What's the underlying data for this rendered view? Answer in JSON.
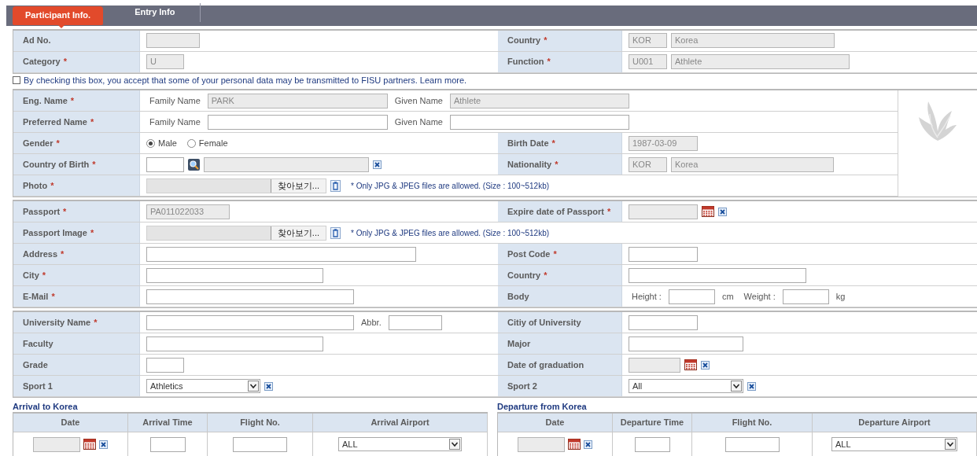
{
  "tabs": [
    {
      "label": "Participant Info.",
      "selected": true
    },
    {
      "label": "Entry Info",
      "selected": false
    }
  ],
  "sections": [
    {
      "rows": [
        {
          "left": {
            "label": "Ad No.",
            "items": [
              {
                "kind": "input",
                "disabled": true
              }
            ]
          },
          "right": {
            "label": "Country",
            "mark": "*",
            "items": [
              {
                "kind": "input",
                "disabled": true,
                "value": "KOR"
              },
              {
                "kind": "input",
                "disabled": true,
                "value": "Korea"
              }
            ]
          }
        },
        {
          "left": {
            "label": "Category",
            "mark": "*",
            "items": [
              {
                "kind": "input",
                "disabled": true,
                "value": "U"
              }
            ]
          },
          "right": {
            "label": "Function",
            "mark": "*",
            "items": [
              {
                "kind": "input",
                "disabled": true,
                "value": "U001"
              },
              {
                "kind": "input",
                "disabled": true,
                "value": "Athlete"
              }
            ]
          }
        }
      ]
    },
    {
      "consent": {
        "checked": false,
        "text": "By checking this box, you accept that some of your personal data may be transmitted to FISU partners.",
        "link": "Learn more."
      }
    },
    {
      "photo": true,
      "rows": [
        {
          "left": {
            "label": "Eng. Name",
            "mark": "*",
            "items": [
              {
                "kind": "caption",
                "text": "Family Name"
              },
              {
                "kind": "input",
                "disabled": true,
                "value": "PARK"
              },
              {
                "kind": "caption",
                "text": "Given Name"
              },
              {
                "kind": "input",
                "disabled": true,
                "value": "Athlete"
              }
            ]
          }
        },
        {
          "left": {
            "label": "Preferred Name",
            "mark": "*",
            "items": [
              {
                "kind": "caption",
                "text": "Family Name"
              },
              {
                "kind": "input",
                "disabled": false
              },
              {
                "kind": "caption",
                "text": "Given Name"
              },
              {
                "kind": "input",
                "disabled": false
              }
            ]
          }
        },
        {
          "left": {
            "label": "Gender",
            "mark": "*",
            "items": [
              {
                "kind": "radio",
                "label": "Male",
                "selected": true
              },
              {
                "kind": "radio",
                "label": "Female",
                "selected": false
              }
            ]
          },
          "right": {
            "label": "Birth Date",
            "mark": "*",
            "items": [
              {
                "kind": "input",
                "disabled": true,
                "value": "1987-03-09"
              }
            ]
          }
        },
        {
          "left": {
            "label": "Country of Birth",
            "mark": "*",
            "items": [
              {
                "kind": "input",
                "disabled": false
              },
              {
                "kind": "search"
              },
              {
                "kind": "input",
                "disabled": true
              },
              {
                "kind": "clear"
              }
            ]
          },
          "right": {
            "label": "Nationality",
            "mark": "*",
            "items": [
              {
                "kind": "input",
                "disabled": true,
                "value": "KOR"
              },
              {
                "kind": "input",
                "disabled": true,
                "value": "Korea"
              }
            ]
          }
        },
        {
          "left": {
            "label": "Photo",
            "mark": "*",
            "items": [
              {
                "kind": "file",
                "button": "찾아보기..."
              },
              {
                "kind": "delete"
              },
              {
                "kind": "note",
                "text": "* Only JPG & JPEG files are allowed. (Size : 100~512kb)"
              }
            ]
          }
        }
      ]
    },
    {
      "rows": [
        {
          "left": {
            "label": "Passport",
            "mark": "*",
            "items": [
              {
                "kind": "input",
                "disabled": true,
                "value": "PA011022033"
              }
            ]
          },
          "right": {
            "label": "Expire date of Passport",
            "mark": "*",
            "items": [
              {
                "kind": "input",
                "disabled": true
              },
              {
                "kind": "calendar"
              },
              {
                "kind": "clear"
              }
            ]
          }
        },
        {
          "left": {
            "label": "Passport Image",
            "mark": "*",
            "items": [
              {
                "kind": "file",
                "button": "찾아보기..."
              },
              {
                "kind": "delete"
              },
              {
                "kind": "note",
                "text": "* Only JPG & JPEG files are allowed. (Size : 100~512kb)"
              }
            ]
          }
        },
        {
          "left": {
            "label": "Address",
            "mark": "*",
            "items": [
              {
                "kind": "input",
                "disabled": false
              }
            ]
          },
          "right": {
            "label": "Post Code",
            "mark": "*",
            "items": [
              {
                "kind": "input",
                "disabled": false
              }
            ]
          }
        },
        {
          "left": {
            "label": "City",
            "mark": "*",
            "items": [
              {
                "kind": "input",
                "disabled": false
              }
            ]
          },
          "right": {
            "label": "Country",
            "mark": "*",
            "items": [
              {
                "kind": "input",
                "disabled": false
              }
            ]
          }
        },
        {
          "left": {
            "label": "E-Mail",
            "mark": "*",
            "items": [
              {
                "kind": "input",
                "disabled": false
              }
            ]
          },
          "right": {
            "label": "Body",
            "items": [
              {
                "kind": "caption",
                "text": "Height :"
              },
              {
                "kind": "input",
                "disabled": false
              },
              {
                "kind": "caption",
                "text": "cm"
              },
              {
                "kind": "caption",
                "text": "Weight :"
              },
              {
                "kind": "input",
                "disabled": false
              },
              {
                "kind": "caption",
                "text": "kg"
              }
            ]
          }
        }
      ]
    },
    {
      "rows": [
        {
          "left": {
            "label": "University Name",
            "mark": "*",
            "items": [
              {
                "kind": "input",
                "disabled": false
              },
              {
                "kind": "caption",
                "text": "Abbr."
              },
              {
                "kind": "input",
                "disabled": false
              }
            ]
          },
          "right": {
            "label": "Citiy of University",
            "items": [
              {
                "kind": "input",
                "disabled": false
              }
            ]
          }
        },
        {
          "left": {
            "label": "Faculty",
            "items": [
              {
                "kind": "input",
                "disabled": false
              }
            ]
          },
          "right": {
            "label": "Major",
            "items": [
              {
                "kind": "input",
                "disabled": false
              }
            ]
          }
        },
        {
          "left": {
            "label": "Grade",
            "items": [
              {
                "kind": "input",
                "disabled": false
              }
            ]
          },
          "right": {
            "label": "Date of graduation",
            "items": [
              {
                "kind": "input",
                "disabled": true
              },
              {
                "kind": "calendar"
              },
              {
                "kind": "clear"
              }
            ]
          }
        },
        {
          "left": {
            "label": "Sport 1",
            "items": [
              {
                "kind": "select",
                "value": "Athletics"
              },
              {
                "kind": "clear"
              }
            ]
          },
          "right": {
            "label": "Sport 2",
            "items": [
              {
                "kind": "select",
                "value": "All"
              },
              {
                "kind": "clear"
              }
            ]
          }
        }
      ]
    }
  ],
  "travel": [
    {
      "title": "Arrival to Korea",
      "columns": [
        "Date",
        "Arrival Time",
        "Flight No.",
        "Arrival Airport"
      ],
      "cells": [
        [
          {
            "kind": "input",
            "disabled": true
          },
          {
            "kind": "calendar"
          },
          {
            "kind": "clear"
          }
        ],
        [
          {
            "kind": "input",
            "disabled": false
          }
        ],
        [
          {
            "kind": "input",
            "disabled": false
          }
        ],
        [
          {
            "kind": "select",
            "value": "ALL"
          }
        ]
      ]
    },
    {
      "title": "Departure from Korea",
      "columns": [
        "Date",
        "Departure Time",
        "Flight No.",
        "Departure Airport"
      ],
      "cells": [
        [
          {
            "kind": "input",
            "disabled": true
          },
          {
            "kind": "calendar"
          },
          {
            "kind": "clear"
          }
        ],
        [
          {
            "kind": "input",
            "disabled": false
          }
        ],
        [
          {
            "kind": "input",
            "disabled": false
          }
        ],
        [
          {
            "kind": "select",
            "value": "ALL"
          }
        ]
      ]
    }
  ]
}
